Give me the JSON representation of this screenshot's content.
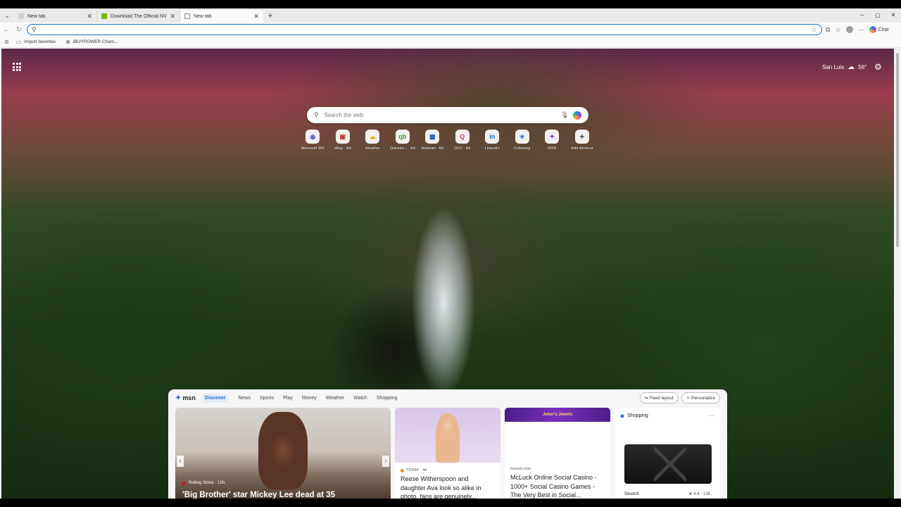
{
  "browser": {
    "tabs": [
      {
        "title": "New tab",
        "favicon_color": "#d0d0d0"
      },
      {
        "title": "Download The Official NVIDIA Dri...",
        "favicon_color": "#76b900"
      },
      {
        "title": "New tab",
        "favicon_color": "#d0d0d0"
      }
    ],
    "address_value": "",
    "chat_label": "Chat",
    "favorites": [
      {
        "label": "Import favorites"
      },
      {
        "label": "iBUYPOWER Cham..."
      }
    ]
  },
  "page": {
    "weather": {
      "location": "San Luis",
      "temp": "56°"
    },
    "search_placeholder": "Search the web",
    "tiles": [
      {
        "label": "Microsoft 365",
        "glyph": "◉",
        "color": "#5b5fc7"
      },
      {
        "label": "eBay · Ad",
        "glyph": "▣",
        "color": "#c0392b"
      },
      {
        "label": "Weather",
        "glyph": "☁",
        "color": "#e6b200"
      },
      {
        "label": "Quickbo... · Ad",
        "glyph": "qb",
        "color": "#2ca01c"
      },
      {
        "label": "Walmart · Ad",
        "glyph": "▦",
        "color": "#1e5fb4"
      },
      {
        "label": "QVC · Ad",
        "glyph": "Q",
        "color": "#d13a6a"
      },
      {
        "label": "LinkedIn",
        "glyph": "in",
        "color": "#0a66c2"
      },
      {
        "label": "Following",
        "glyph": "★",
        "color": "#3a78e7"
      },
      {
        "label": "MSN",
        "glyph": "✦",
        "color": "#7a3ad6"
      },
      {
        "label": "Add shortcut",
        "glyph": "+",
        "color": "#444444"
      }
    ]
  },
  "feed": {
    "brand": "msn",
    "tabs": [
      "Discover",
      "News",
      "Sports",
      "Play",
      "Money",
      "Weather",
      "Watch",
      "Shopping"
    ],
    "feed_layout": "Feed layout",
    "personalize": "Personalize",
    "hero": {
      "source": "Rolling Stone · 13h",
      "headline": "'Big Brother' star Mickey Lee dead at 35"
    },
    "card2": {
      "source": "TODAY · 4d",
      "title": "Reese Witherspoon and daughter Ava look so alike in photo, fans are genuinely..."
    },
    "card3": {
      "banner": "Joker's Jewels",
      "source": "mcluck.com",
      "title": "McLuck Online Social Casino - 1000+ Social Casino Games - The Very Best in Social..."
    },
    "shopping": {
      "label": "Shopping",
      "brand": "StockX",
      "rating": "★ 4.4 · 136"
    }
  }
}
